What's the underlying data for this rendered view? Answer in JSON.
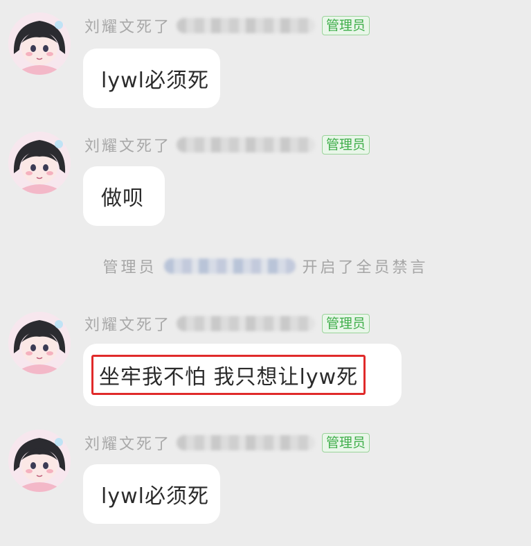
{
  "messages": [
    {
      "sender": "刘耀文死了",
      "role_badge": "管理员",
      "text": "lywl必须死"
    },
    {
      "sender": "刘耀文死了",
      "role_badge": "管理员",
      "text": "做呗"
    },
    {
      "sender": "刘耀文死了",
      "role_badge": "管理员",
      "text": "坐牢我不怕 我只想让lyw死"
    },
    {
      "sender": "刘耀文死了",
      "role_badge": "管理员",
      "text": "lywl必须死"
    }
  ],
  "system_notice": {
    "prefix": "管理员",
    "suffix": "开启了全员禁言"
  },
  "colors": {
    "badge_text": "#3fae4a",
    "highlight_border": "#e02a2a",
    "background": "#ececec"
  }
}
